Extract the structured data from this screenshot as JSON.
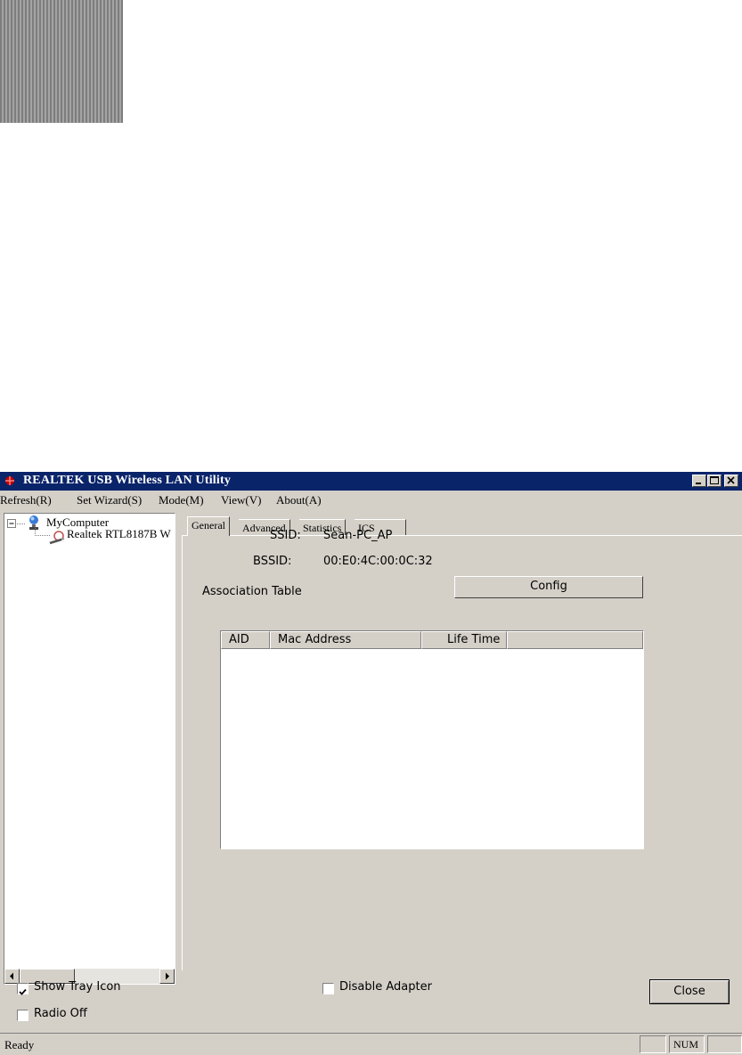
{
  "window": {
    "title": "REALTEK USB Wireless LAN Utility"
  },
  "menu": [
    "Refresh(R)",
    "Set Wizard(S)",
    "Mode(M)",
    "View(V)",
    "About(A)"
  ],
  "tree": {
    "root": "MyComputer",
    "child": "Realtek RTL8187B W"
  },
  "tabs": [
    "General",
    "Advanced",
    "Statistics",
    "ICS"
  ],
  "general": {
    "ssid_label": "SSID:",
    "ssid_value": "Sean-PC_AP",
    "bssid_label": "BSSID:",
    "bssid_value": "00:E0:4C:00:0C:32",
    "assoc_label": "Association Table",
    "config_button": "Config",
    "columns": [
      "AID",
      "Mac Address",
      "Life Time"
    ]
  },
  "options": {
    "show_tray_icon": "Show Tray Icon",
    "show_tray_icon_checked": true,
    "disable_adapter": "Disable Adapter",
    "disable_adapter_checked": false,
    "radio_off": "Radio Off",
    "radio_off_checked": false,
    "close_button": "Close"
  },
  "status": {
    "text": "Ready",
    "num": "NUM"
  },
  "colors": {
    "titlebar": "#0a246a",
    "face": "#d4d0c8"
  }
}
